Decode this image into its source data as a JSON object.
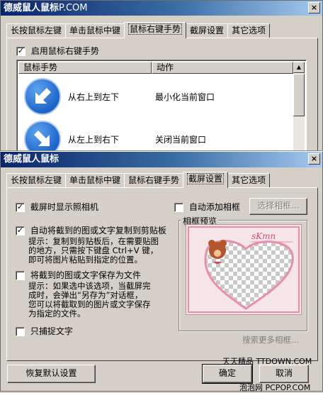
{
  "back_window": {
    "title": "德威鼠人鼠标",
    "title_overlay": "P.COM",
    "tabs": [
      "长按鼠标左键",
      "单击鼠标中键",
      "鼠标右键手势",
      "截屏设置",
      "其它选项"
    ],
    "active_tab": "鼠标右键手势",
    "enable_checkbox": {
      "label": "启用鼠标右键手势",
      "checked": true
    },
    "list": {
      "columns": [
        "鼠标手势",
        "动作"
      ],
      "rows": [
        {
          "gesture": "从右上到左下",
          "action": "最小化当前窗口",
          "icon": "arrow-down-left-icon"
        },
        {
          "gesture": "从左上到右下",
          "action": "关闭当前窗口",
          "icon": "arrow-down-right-icon"
        }
      ]
    },
    "close_glyph": "×"
  },
  "front_window": {
    "title": "德威鼠人鼠标",
    "close_glyph": "×",
    "tabs": [
      "长按鼠标左键",
      "单击鼠标中键",
      "鼠标右键手势",
      "截屏设置",
      "其它选项"
    ],
    "active_tab": "截屏设置",
    "options": {
      "show_camera": {
        "label": "截屏时显示照相机",
        "checked": true
      },
      "copy_clipboard": {
        "label": "自动将截到的图或文字复制到剪贴板",
        "checked": true,
        "hint": [
          "提示：复制到剪贴板后，在需要贴图",
          "的地方，只需按下键盘 Ctrl+V 键，",
          "即可将图片粘贴到指定的位置。"
        ]
      },
      "save_file": {
        "label": "将截到的图或文字保存为文件",
        "checked": false,
        "hint": [
          "提示：如果选中该选项，当截屏完",
          "成时，会弹出“另存为”对话框，",
          "您可以将截取到的图片或文字保存",
          "为指定的文件。"
        ]
      },
      "text_only": {
        "label": "只捕捉文字",
        "checked": false
      }
    },
    "auto_frame": {
      "label": "自动添加相框",
      "checked": false
    },
    "select_frame_button": "选择相框...",
    "preview_group": "相框预览",
    "preview_text": "sKmn",
    "search_more_link": "搜索更多相框...",
    "buttons": {
      "restore": "恢复默认设置",
      "ok": "确定",
      "cancel": "取消"
    }
  },
  "watermarks": {
    "upper": "天天精品 TTDOWN.COM",
    "lower": "泡泡网 PCPOP.COM"
  },
  "colors": {
    "title_active": "#0a246a",
    "face": "#d4d0c8",
    "arrow_icon": "#1e64c8",
    "frame_pink": "#e88fa8"
  }
}
